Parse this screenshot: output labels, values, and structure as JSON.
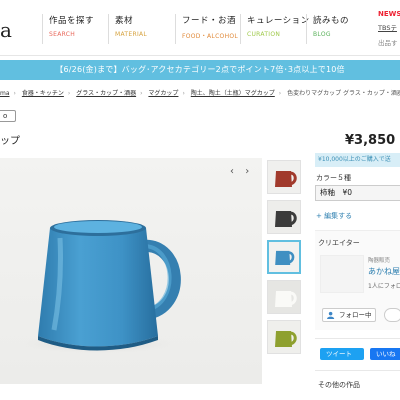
{
  "header": {
    "logo": "a",
    "nav": [
      {
        "jp": "作品を探す",
        "en": "SEARCH",
        "color": "#e8675a"
      },
      {
        "jp": "素材",
        "en": "MATERIAL",
        "color": "#d6a23e"
      },
      {
        "jp": "フード・お酒",
        "en": "FOOD・ALCOHOL",
        "color": "#e08a3a"
      },
      {
        "jp": "キュレーション",
        "en": "CURATION",
        "color": "#9fc94a"
      },
      {
        "jp": "読みもの",
        "en": "BLOG",
        "color": "#5ab15a"
      }
    ],
    "news": {
      "label": "NEWS",
      "line1": "TBSテ",
      "line2": "出品す"
    }
  },
  "promo": {
    "text": "【6/26(金)まで】バッグ･アクセカテゴリー2点でポイント7倍･3点以上で10倍"
  },
  "breadcrumbs": [
    "ma",
    "食器・キッチン",
    "グラス・カップ・酒器",
    "マグカップ",
    "陶土、陶土（土瓶）マグカップ",
    "色変わりマグカップ グラス・カップ・酒器"
  ],
  "tag": "o",
  "product": {
    "title": "ップ",
    "price": "¥3,850",
    "shipping": "¥10,000以上のご購入で送",
    "color_label": "カラー５種",
    "selected_option": "柿釉　¥0",
    "edit_link": "+ 編集する"
  },
  "gallery": {
    "prev": "‹",
    "next": "›",
    "thumbs": [
      {
        "name": "red-mug",
        "color": "#a13a2c"
      },
      {
        "name": "black-mug",
        "color": "#3b3b3b"
      },
      {
        "name": "blue-mug",
        "color": "#3f8fc2"
      },
      {
        "name": "white-mug",
        "color": "#efefea"
      },
      {
        "name": "green-mug",
        "color": "#8ea02f"
      }
    ]
  },
  "creator": {
    "heading": "クリエイター",
    "sub": "陶器販売",
    "name": "あかね屋",
    "count": "1人にフォロ",
    "follow": "フォロー中"
  },
  "share": {
    "tweet": "ツイート",
    "like": "いいね"
  },
  "other": {
    "heading": "その他の作品"
  }
}
